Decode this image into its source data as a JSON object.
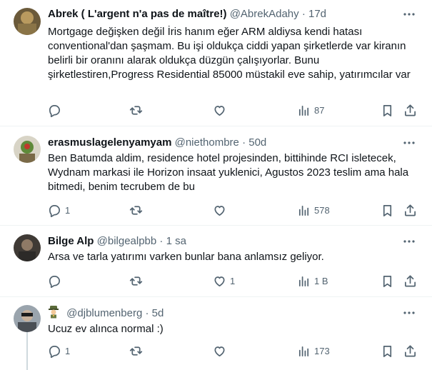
{
  "tweets": [
    {
      "name": "Abrek ( L'argent n'a pas de maître!)",
      "handle": "@AbrekAdahy",
      "sep": "·",
      "time": "17d",
      "text": "Mortgage değişken değil İris hanım eğer ARM aldiysa kendi hatası conventional'dan şaşmam. Bu işi oldukça ciddi yapan şirketlerde var kiranın belirli bir oranını alarak oldukça düzgün çalışıyorlar. Bunu şirketlestiren,Progress Residential 85000 müstakil eve sahip, yatırımcılar var",
      "replies": "",
      "retweets": "",
      "likes": "",
      "views": "87"
    },
    {
      "name": "erasmuslagelenyamyam",
      "handle": "@niethombre",
      "sep": "·",
      "time": "50d",
      "text": "Ben Batumda aldim, residence hotel projesinden, bittihinde RCI isletecek, Wydnam markasi ile Horizon insaat yuklenici, Agustos 2023 teslim ama hala bitmedi, benim tecrubem de bu",
      "replies": "1",
      "retweets": "",
      "likes": "",
      "views": "578"
    },
    {
      "name": "Bilge Alp",
      "handle": "@bilgealpbb",
      "sep": "·",
      "time": "1 sa",
      "text": "Arsa ve tarla yatırımı varken bunlar bana anlamsız geliyor.",
      "replies": "",
      "retweets": "",
      "likes": "1",
      "views": "1 B"
    },
    {
      "name": "",
      "handle": "@djblumenberg",
      "sep": "·",
      "time": "5d",
      "text": "Ucuz ev alınca normal :)",
      "replies": "1",
      "retweets": "",
      "likes": "",
      "views": "173"
    }
  ],
  "icons": {
    "reply": "reply-icon",
    "retweet": "retweet-icon",
    "like": "like-icon",
    "views": "views-icon",
    "bookmark": "bookmark-icon",
    "share": "share-icon",
    "more": "more-options-icon"
  },
  "colors": {
    "text": "#0f1419",
    "muted": "#536471",
    "divider": "#eff3f4"
  }
}
